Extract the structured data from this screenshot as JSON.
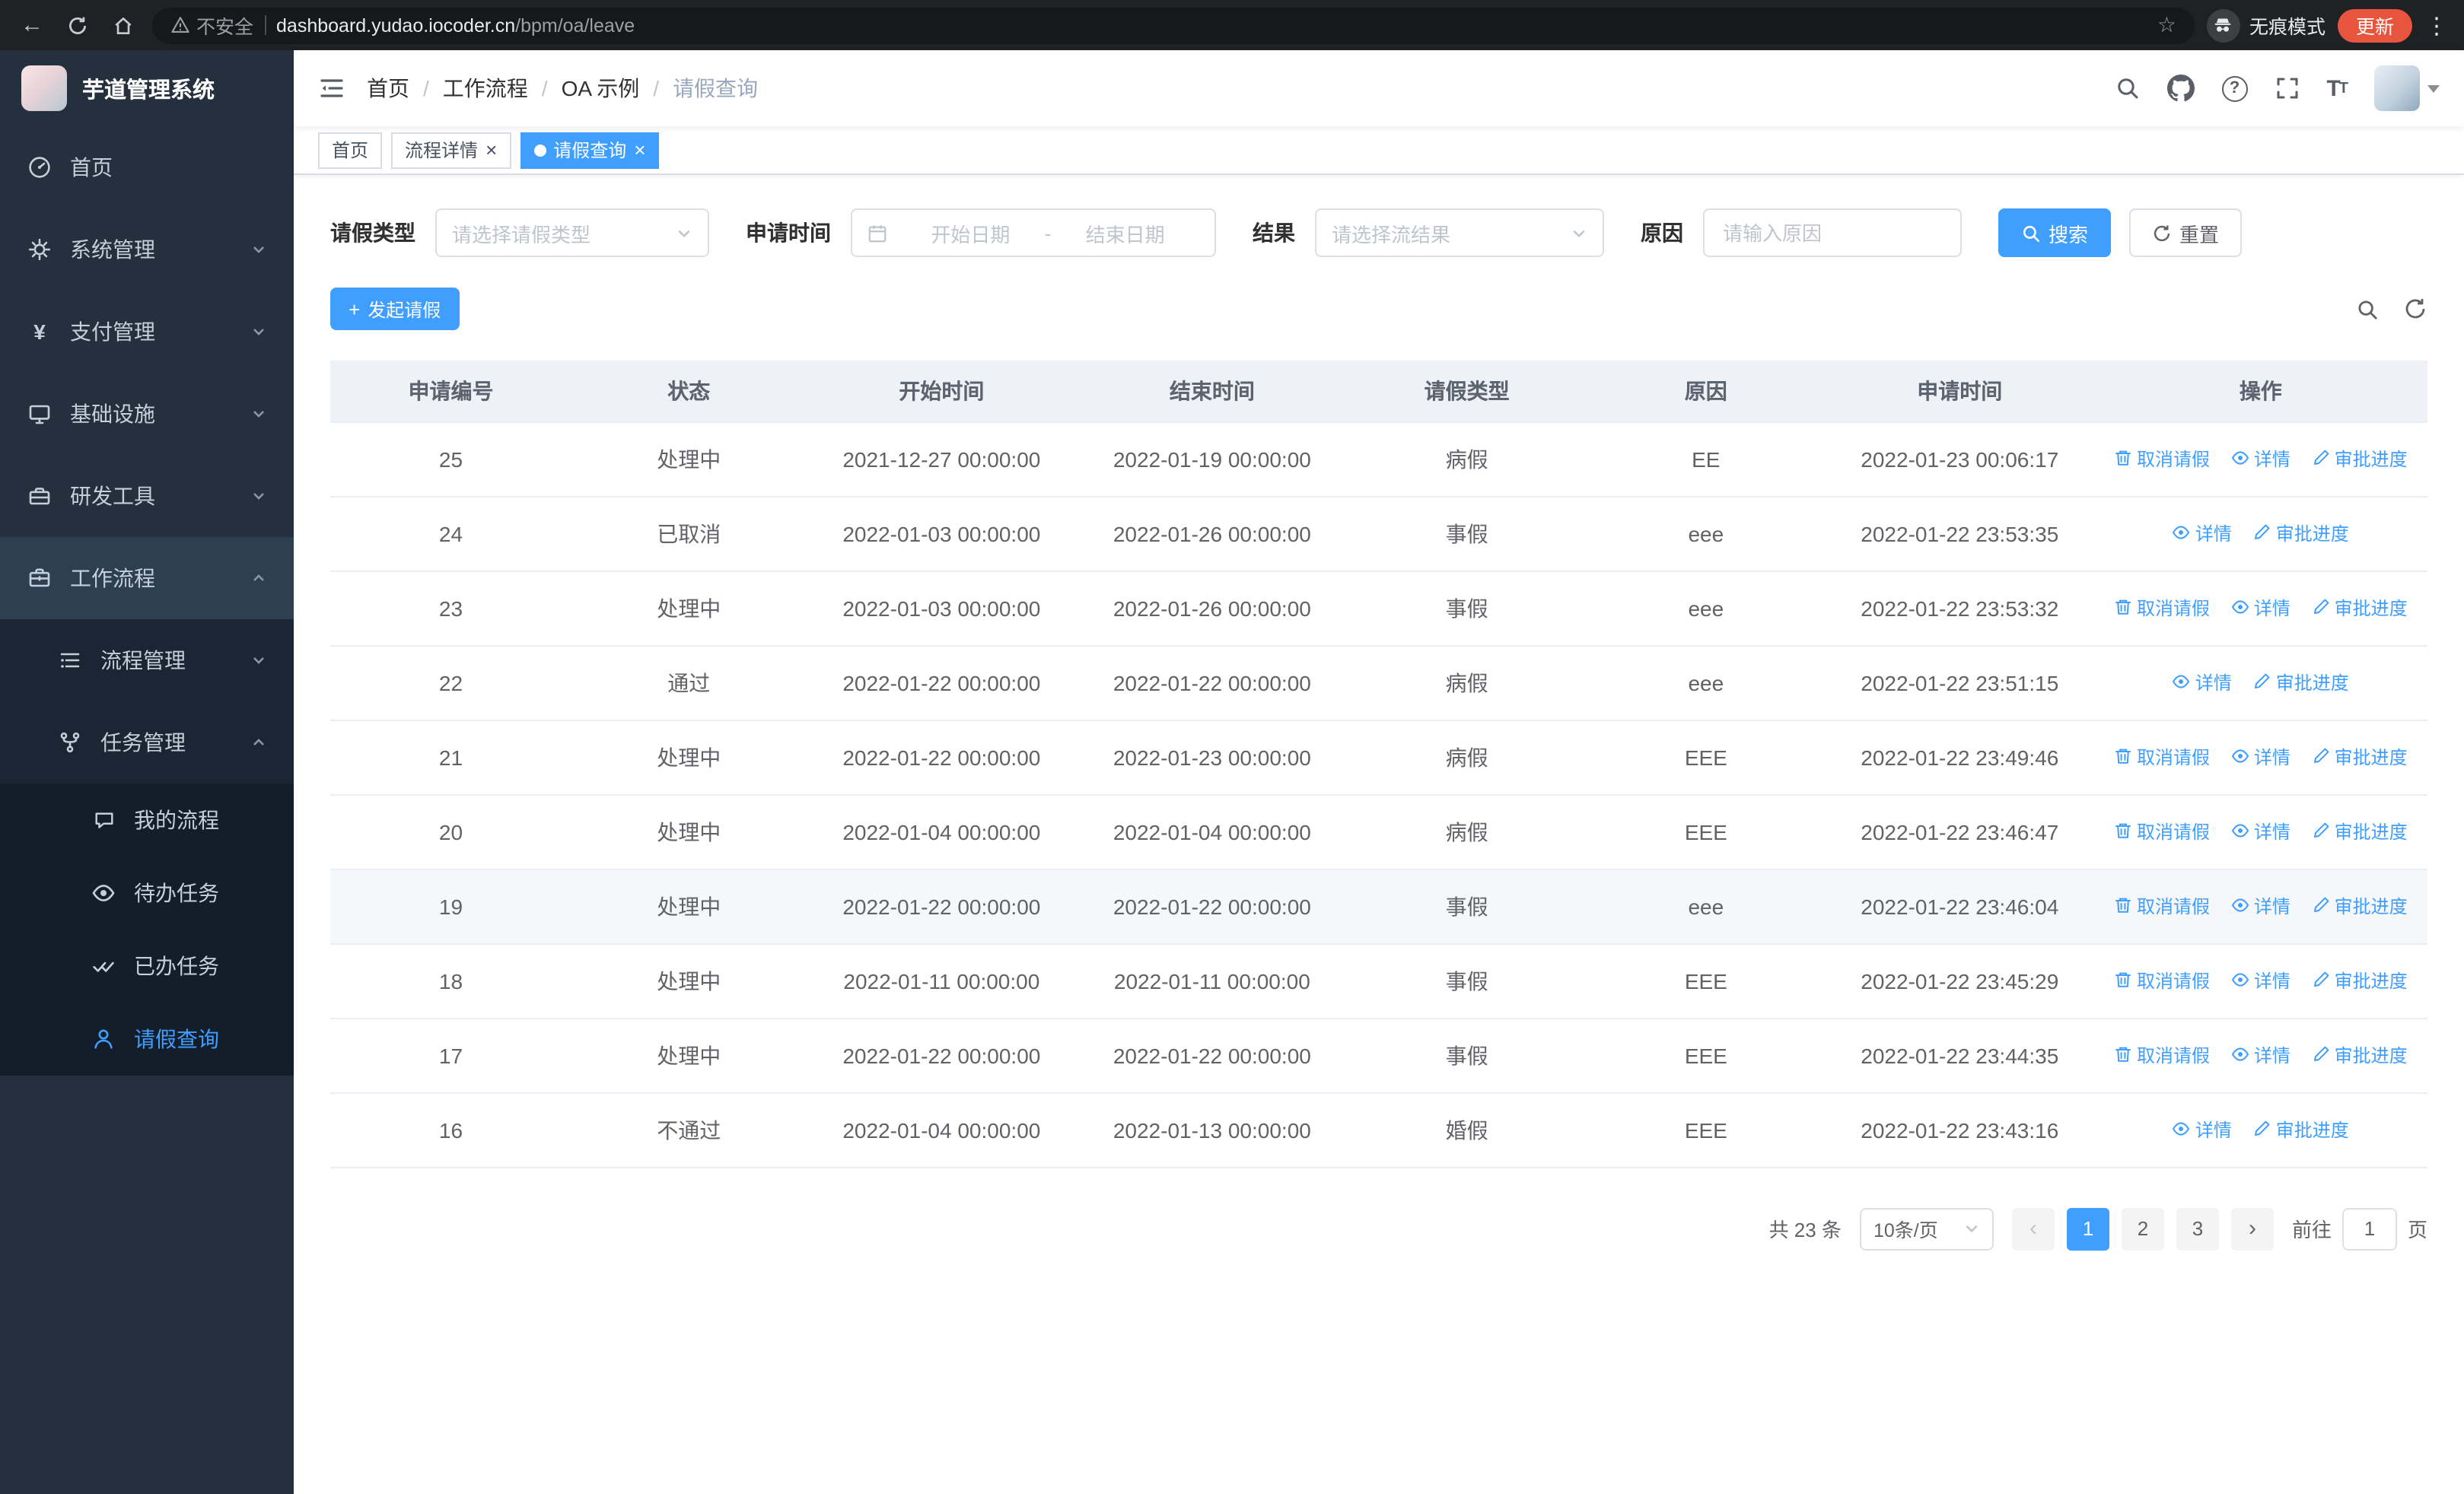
{
  "browser": {
    "security_warning": "不安全",
    "url_host": "dashboard.yudao.iocoder.cn",
    "url_path": "/bpm/oa/leave",
    "incognito_label": "无痕模式",
    "update_button": "更新"
  },
  "sidebar": {
    "logo_title": "芋道管理系统",
    "items": [
      {
        "label": "首页",
        "icon": "dashboard-icon"
      },
      {
        "label": "系统管理",
        "icon": "gear-icon"
      },
      {
        "label": "支付管理",
        "icon": "yen-icon"
      },
      {
        "label": "基础设施",
        "icon": "monitor-icon"
      },
      {
        "label": "研发工具",
        "icon": "toolbox-icon"
      },
      {
        "label": "工作流程",
        "icon": "briefcase-icon"
      }
    ],
    "submenu": [
      {
        "label": "流程管理",
        "icon": "list-tree-icon"
      },
      {
        "label": "任务管理",
        "icon": "branch-icon"
      }
    ],
    "leaf_items": [
      {
        "label": "我的流程",
        "icon": "chat-icon"
      },
      {
        "label": "待办任务",
        "icon": "eye-icon"
      },
      {
        "label": "已办任务",
        "icon": "double-check-icon"
      },
      {
        "label": "请假查询",
        "icon": "user-icon"
      }
    ]
  },
  "header": {
    "breadcrumb": [
      "首页",
      "工作流程",
      "OA 示例",
      "请假查询"
    ],
    "separator": "/"
  },
  "tabs": [
    {
      "label": "首页"
    },
    {
      "label": "流程详情"
    },
    {
      "label": "请假查询"
    }
  ],
  "filters": {
    "leave_type_label": "请假类型",
    "leave_type_placeholder": "请选择请假类型",
    "apply_time_label": "申请时间",
    "date_start_placeholder": "开始日期",
    "date_separator": "-",
    "date_end_placeholder": "结束日期",
    "result_label": "结果",
    "result_placeholder": "请选择流结果",
    "reason_label": "原因",
    "reason_placeholder": "请输入原因",
    "search_button": "搜索",
    "reset_button": "重置"
  },
  "toolbar": {
    "create_button": "发起请假"
  },
  "table": {
    "columns": [
      "申请编号",
      "状态",
      "开始时间",
      "结束时间",
      "请假类型",
      "原因",
      "申请时间",
      "操作"
    ],
    "actions": {
      "cancel": "取消请假",
      "detail": "详情",
      "progress": "审批进度"
    },
    "rows": [
      {
        "id": "25",
        "status": "处理中",
        "start": "2021-12-27 00:00:00",
        "end": "2022-01-19 00:00:00",
        "type": "病假",
        "reason": "EE",
        "apply_time": "2022-01-23 00:06:17",
        "cancellable": true,
        "highlighted": false
      },
      {
        "id": "24",
        "status": "已取消",
        "start": "2022-01-03 00:00:00",
        "end": "2022-01-26 00:00:00",
        "type": "事假",
        "reason": "eee",
        "apply_time": "2022-01-22 23:53:35",
        "cancellable": false,
        "highlighted": false
      },
      {
        "id": "23",
        "status": "处理中",
        "start": "2022-01-03 00:00:00",
        "end": "2022-01-26 00:00:00",
        "type": "事假",
        "reason": "eee",
        "apply_time": "2022-01-22 23:53:32",
        "cancellable": true,
        "highlighted": false
      },
      {
        "id": "22",
        "status": "通过",
        "start": "2022-01-22 00:00:00",
        "end": "2022-01-22 00:00:00",
        "type": "病假",
        "reason": "eee",
        "apply_time": "2022-01-22 23:51:15",
        "cancellable": false,
        "highlighted": false
      },
      {
        "id": "21",
        "status": "处理中",
        "start": "2022-01-22 00:00:00",
        "end": "2022-01-23 00:00:00",
        "type": "病假",
        "reason": "EEE",
        "apply_time": "2022-01-22 23:49:46",
        "cancellable": true,
        "highlighted": false
      },
      {
        "id": "20",
        "status": "处理中",
        "start": "2022-01-04 00:00:00",
        "end": "2022-01-04 00:00:00",
        "type": "病假",
        "reason": "EEE",
        "apply_time": "2022-01-22 23:46:47",
        "cancellable": true,
        "highlighted": false
      },
      {
        "id": "19",
        "status": "处理中",
        "start": "2022-01-22 00:00:00",
        "end": "2022-01-22 00:00:00",
        "type": "事假",
        "reason": "eee",
        "apply_time": "2022-01-22 23:46:04",
        "cancellable": true,
        "highlighted": true
      },
      {
        "id": "18",
        "status": "处理中",
        "start": "2022-01-11 00:00:00",
        "end": "2022-01-11 00:00:00",
        "type": "事假",
        "reason": "EEE",
        "apply_time": "2022-01-22 23:45:29",
        "cancellable": true,
        "highlighted": false
      },
      {
        "id": "17",
        "status": "处理中",
        "start": "2022-01-22 00:00:00",
        "end": "2022-01-22 00:00:00",
        "type": "事假",
        "reason": "EEE",
        "apply_time": "2022-01-22 23:44:35",
        "cancellable": true,
        "highlighted": false
      },
      {
        "id": "16",
        "status": "不通过",
        "start": "2022-01-04 00:00:00",
        "end": "2022-01-13 00:00:00",
        "type": "婚假",
        "reason": "EEE",
        "apply_time": "2022-01-22 23:43:16",
        "cancellable": false,
        "highlighted": false
      }
    ]
  },
  "pagination": {
    "total_text": "共 23 条",
    "page_size": "10条/页",
    "pages": [
      "1",
      "2",
      "3"
    ],
    "active_page": "1",
    "goto_label": "前往",
    "goto_value": "1",
    "goto_suffix": "页"
  },
  "colors": {
    "primary": "#409eff",
    "sidebar_bg": "#25303e",
    "update_button_bg": "#e8553e"
  }
}
